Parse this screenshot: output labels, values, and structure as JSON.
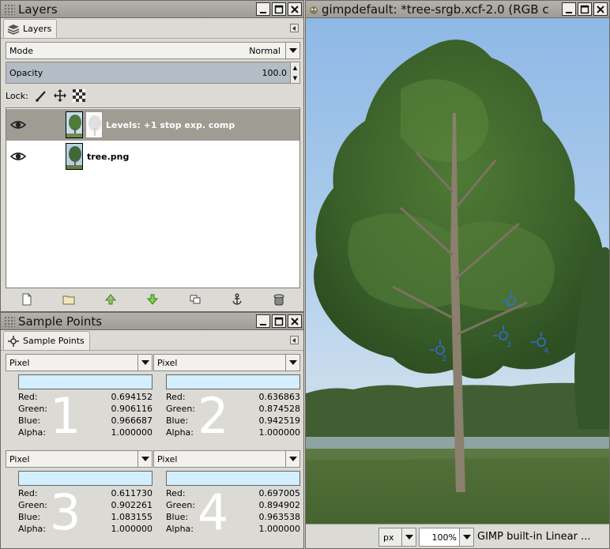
{
  "layers_window": {
    "title": "Layers",
    "tab_label": "Layers",
    "mode_label": "Mode",
    "mode_value": "Normal",
    "opacity_label": "Opacity",
    "opacity_value": "100.0",
    "lock_label": "Lock:",
    "layers": [
      {
        "name": "Levels: +1 stop exp. comp",
        "visible": true,
        "selected": true
      },
      {
        "name": "tree.png",
        "visible": true,
        "selected": false
      }
    ],
    "buttons": [
      "new-layer-icon",
      "new-layer-group-icon",
      "raise-layer-icon",
      "lower-layer-icon",
      "duplicate-layer-icon",
      "anchor-icon",
      "delete-icon"
    ]
  },
  "sample_points_window": {
    "title": "Sample Points",
    "tab_label": "Sample Points",
    "points": [
      {
        "number": "1",
        "mode": "Pixel",
        "red_label": "Red:",
        "red": "0.694152",
        "green_label": "Green:",
        "green": "0.906116",
        "blue_label": "Blue:",
        "blue": "0.966687",
        "alpha_label": "Alpha:",
        "alpha": "1.000000"
      },
      {
        "number": "2",
        "mode": "Pixel",
        "red_label": "Red:",
        "red": "0.636863",
        "green_label": "Green:",
        "green": "0.874528",
        "blue_label": "Blue:",
        "blue": "0.942519",
        "alpha_label": "Alpha:",
        "alpha": "1.000000"
      },
      {
        "number": "3",
        "mode": "Pixel",
        "red_label": "Red:",
        "red": "0.611730",
        "green_label": "Green:",
        "green": "0.902261",
        "blue_label": "Blue:",
        "blue": "1.083155",
        "alpha_label": "Alpha:",
        "alpha": "1.000000"
      },
      {
        "number": "4",
        "mode": "Pixel",
        "red_label": "Red:",
        "red": "0.697005",
        "green_label": "Green:",
        "green": "0.894902",
        "blue_label": "Blue:",
        "blue": "0.963538",
        "alpha_label": "Alpha:",
        "alpha": "1.000000"
      }
    ]
  },
  "image_window": {
    "title": "gimpdefault: *tree-srgb.xcf-2.0 (RGB c",
    "canvas_markers": [
      "1",
      "2",
      "3",
      "4"
    ],
    "status": {
      "unit": "px",
      "zoom": "100%",
      "profile": "GIMP built-in Linear ..."
    }
  },
  "colors": {
    "swatch": "#d3efff",
    "selected_layer": "#9f9c94",
    "opacity_fill": "#b4bcc6",
    "sample_marker": "#2f6fd6"
  }
}
